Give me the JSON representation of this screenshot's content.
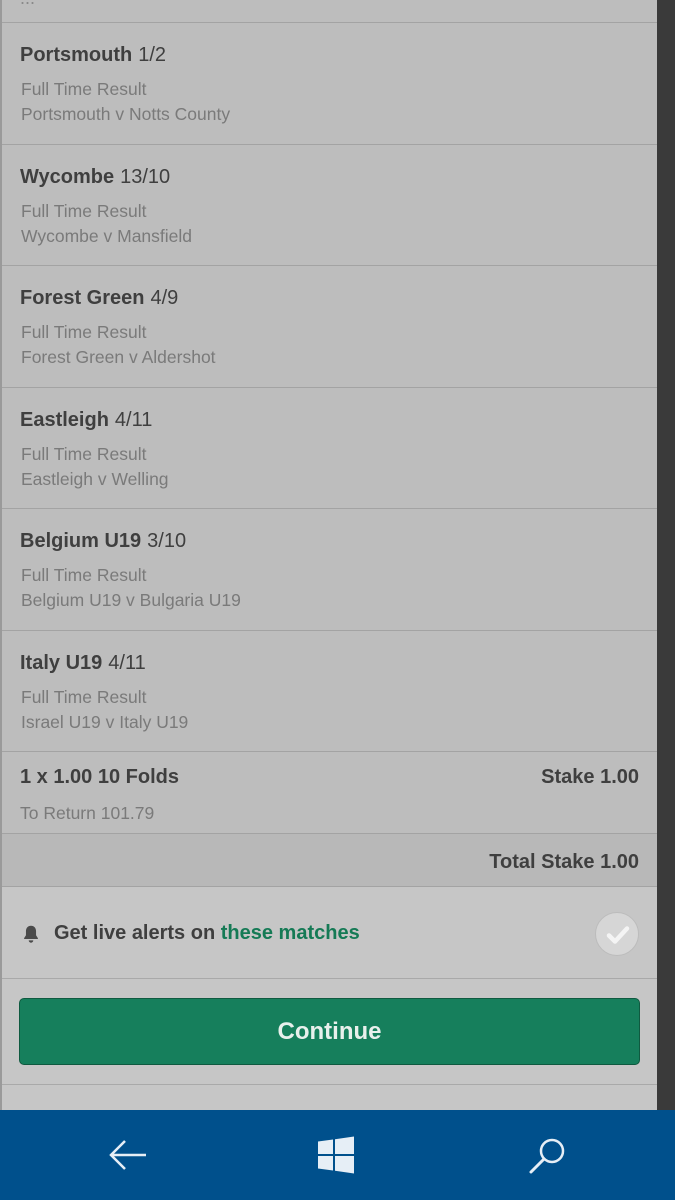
{
  "cut_row": {
    "text": "..."
  },
  "selections": [
    {
      "team": "Portsmouth",
      "odds": "1/2",
      "market": "Full Time Result",
      "match": "Portsmouth v Notts County"
    },
    {
      "team": "Wycombe",
      "odds": "13/10",
      "market": "Full Time Result",
      "match": "Wycombe v Mansfield"
    },
    {
      "team": "Forest Green",
      "odds": "4/9",
      "market": "Full Time Result",
      "match": "Forest Green v Aldershot"
    },
    {
      "team": "Eastleigh",
      "odds": "4/11",
      "market": "Full Time Result",
      "match": "Eastleigh v Welling"
    },
    {
      "team": "Belgium U19",
      "odds": "3/10",
      "market": "Full Time Result",
      "match": "Belgium U19 v Bulgaria U19"
    },
    {
      "team": "Italy U19",
      "odds": "4/11",
      "market": "Full Time Result",
      "match": "Israel U19 v Italy U19"
    }
  ],
  "folds": {
    "title": "1 x 1.00 10 Folds",
    "stake": "Stake 1.00",
    "to_return": "To Return 101.79"
  },
  "total_stake": "Total Stake 1.00",
  "alerts": {
    "prefix": "Get live alerts on ",
    "link": "these matches",
    "icon": "bell-icon",
    "check_icon": "check-icon"
  },
  "continue_label": "Continue",
  "navbar": {
    "back_icon": "back-arrow-icon",
    "windows_icon": "windows-logo-icon",
    "search_icon": "search-icon"
  },
  "colors": {
    "accent": "#167f5c",
    "link": "#157a55",
    "navbar": "#00508c"
  }
}
